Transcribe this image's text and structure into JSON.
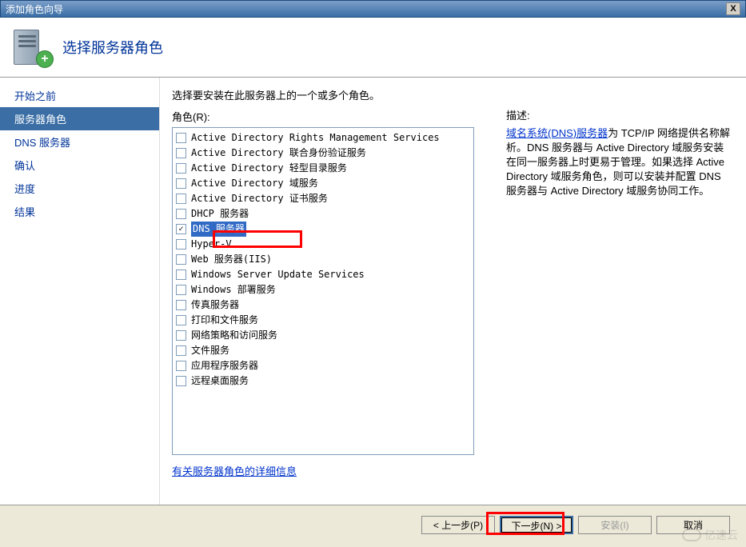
{
  "window": {
    "title": "添加角色向导",
    "close_label": "X"
  },
  "header": {
    "title": "选择服务器角色"
  },
  "sidebar": {
    "items": [
      {
        "label": "开始之前",
        "selected": false
      },
      {
        "label": "服务器角色",
        "selected": true
      },
      {
        "label": "DNS 服务器",
        "selected": false
      },
      {
        "label": "确认",
        "selected": false
      },
      {
        "label": "进度",
        "selected": false
      },
      {
        "label": "结果",
        "selected": false
      }
    ]
  },
  "main": {
    "intro": "选择要安装在此服务器上的一个或多个角色。",
    "roles_label": "角色(R):",
    "roles": [
      {
        "label": "Active Directory Rights Management Services",
        "checked": false,
        "highlighted": false
      },
      {
        "label": "Active Directory 联合身份验证服务",
        "checked": false,
        "highlighted": false
      },
      {
        "label": "Active Directory 轻型目录服务",
        "checked": false,
        "highlighted": false
      },
      {
        "label": "Active Directory 域服务",
        "checked": false,
        "highlighted": false
      },
      {
        "label": "Active Directory 证书服务",
        "checked": false,
        "highlighted": false
      },
      {
        "label": "DHCP 服务器",
        "checked": false,
        "highlighted": false
      },
      {
        "label": "DNS 服务器",
        "checked": true,
        "highlighted": true
      },
      {
        "label": "Hyper-V",
        "checked": false,
        "highlighted": false
      },
      {
        "label": "Web 服务器(IIS)",
        "checked": false,
        "highlighted": false
      },
      {
        "label": "Windows Server Update Services",
        "checked": false,
        "highlighted": false
      },
      {
        "label": "Windows 部署服务",
        "checked": false,
        "highlighted": false
      },
      {
        "label": "传真服务器",
        "checked": false,
        "highlighted": false
      },
      {
        "label": "打印和文件服务",
        "checked": false,
        "highlighted": false
      },
      {
        "label": "网络策略和访问服务",
        "checked": false,
        "highlighted": false
      },
      {
        "label": "文件服务",
        "checked": false,
        "highlighted": false
      },
      {
        "label": "应用程序服务器",
        "checked": false,
        "highlighted": false
      },
      {
        "label": "远程桌面服务",
        "checked": false,
        "highlighted": false
      }
    ],
    "more_info_link": "有关服务器角色的详细信息",
    "description_label": "描述:",
    "description_link": "域名系统(DNS)服务器",
    "description_text": "为 TCP/IP 网络提供名称解析。DNS 服务器与 Active Directory 域服务安装在同一服务器上时更易于管理。如果选择 Active Directory 域服务角色，则可以安装并配置 DNS 服务器与 Active Directory 域服务协同工作。"
  },
  "buttons": {
    "prev": "< 上一步(P)",
    "next": "下一步(N) >",
    "install": "安装(I)",
    "cancel": "取消"
  },
  "watermark": "亿速云"
}
